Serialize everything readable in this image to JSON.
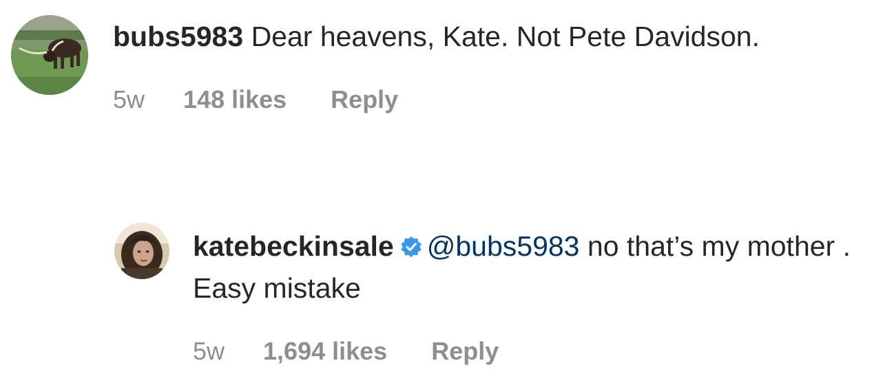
{
  "comments": [
    {
      "username": "bubs5983",
      "verified": false,
      "mention": "",
      "text": "Dear heavens, Kate. Not Pete Davidson.",
      "time": "5w",
      "likes": "148 likes",
      "reply_label": "Reply",
      "avatar_icon": "cattle-photo-avatar"
    },
    {
      "username": "katebeckinsale",
      "verified": true,
      "mention": "@bubs5983",
      "text": "no that’s my mother . Easy mistake",
      "time": "5w",
      "likes": "1,694 likes",
      "reply_label": "Reply",
      "avatar_icon": "portrait-photo-avatar"
    }
  ],
  "colors": {
    "text": "#262626",
    "mention": "#003569",
    "meta": "#8e8e8e",
    "verified_badge": "#3897f0"
  }
}
